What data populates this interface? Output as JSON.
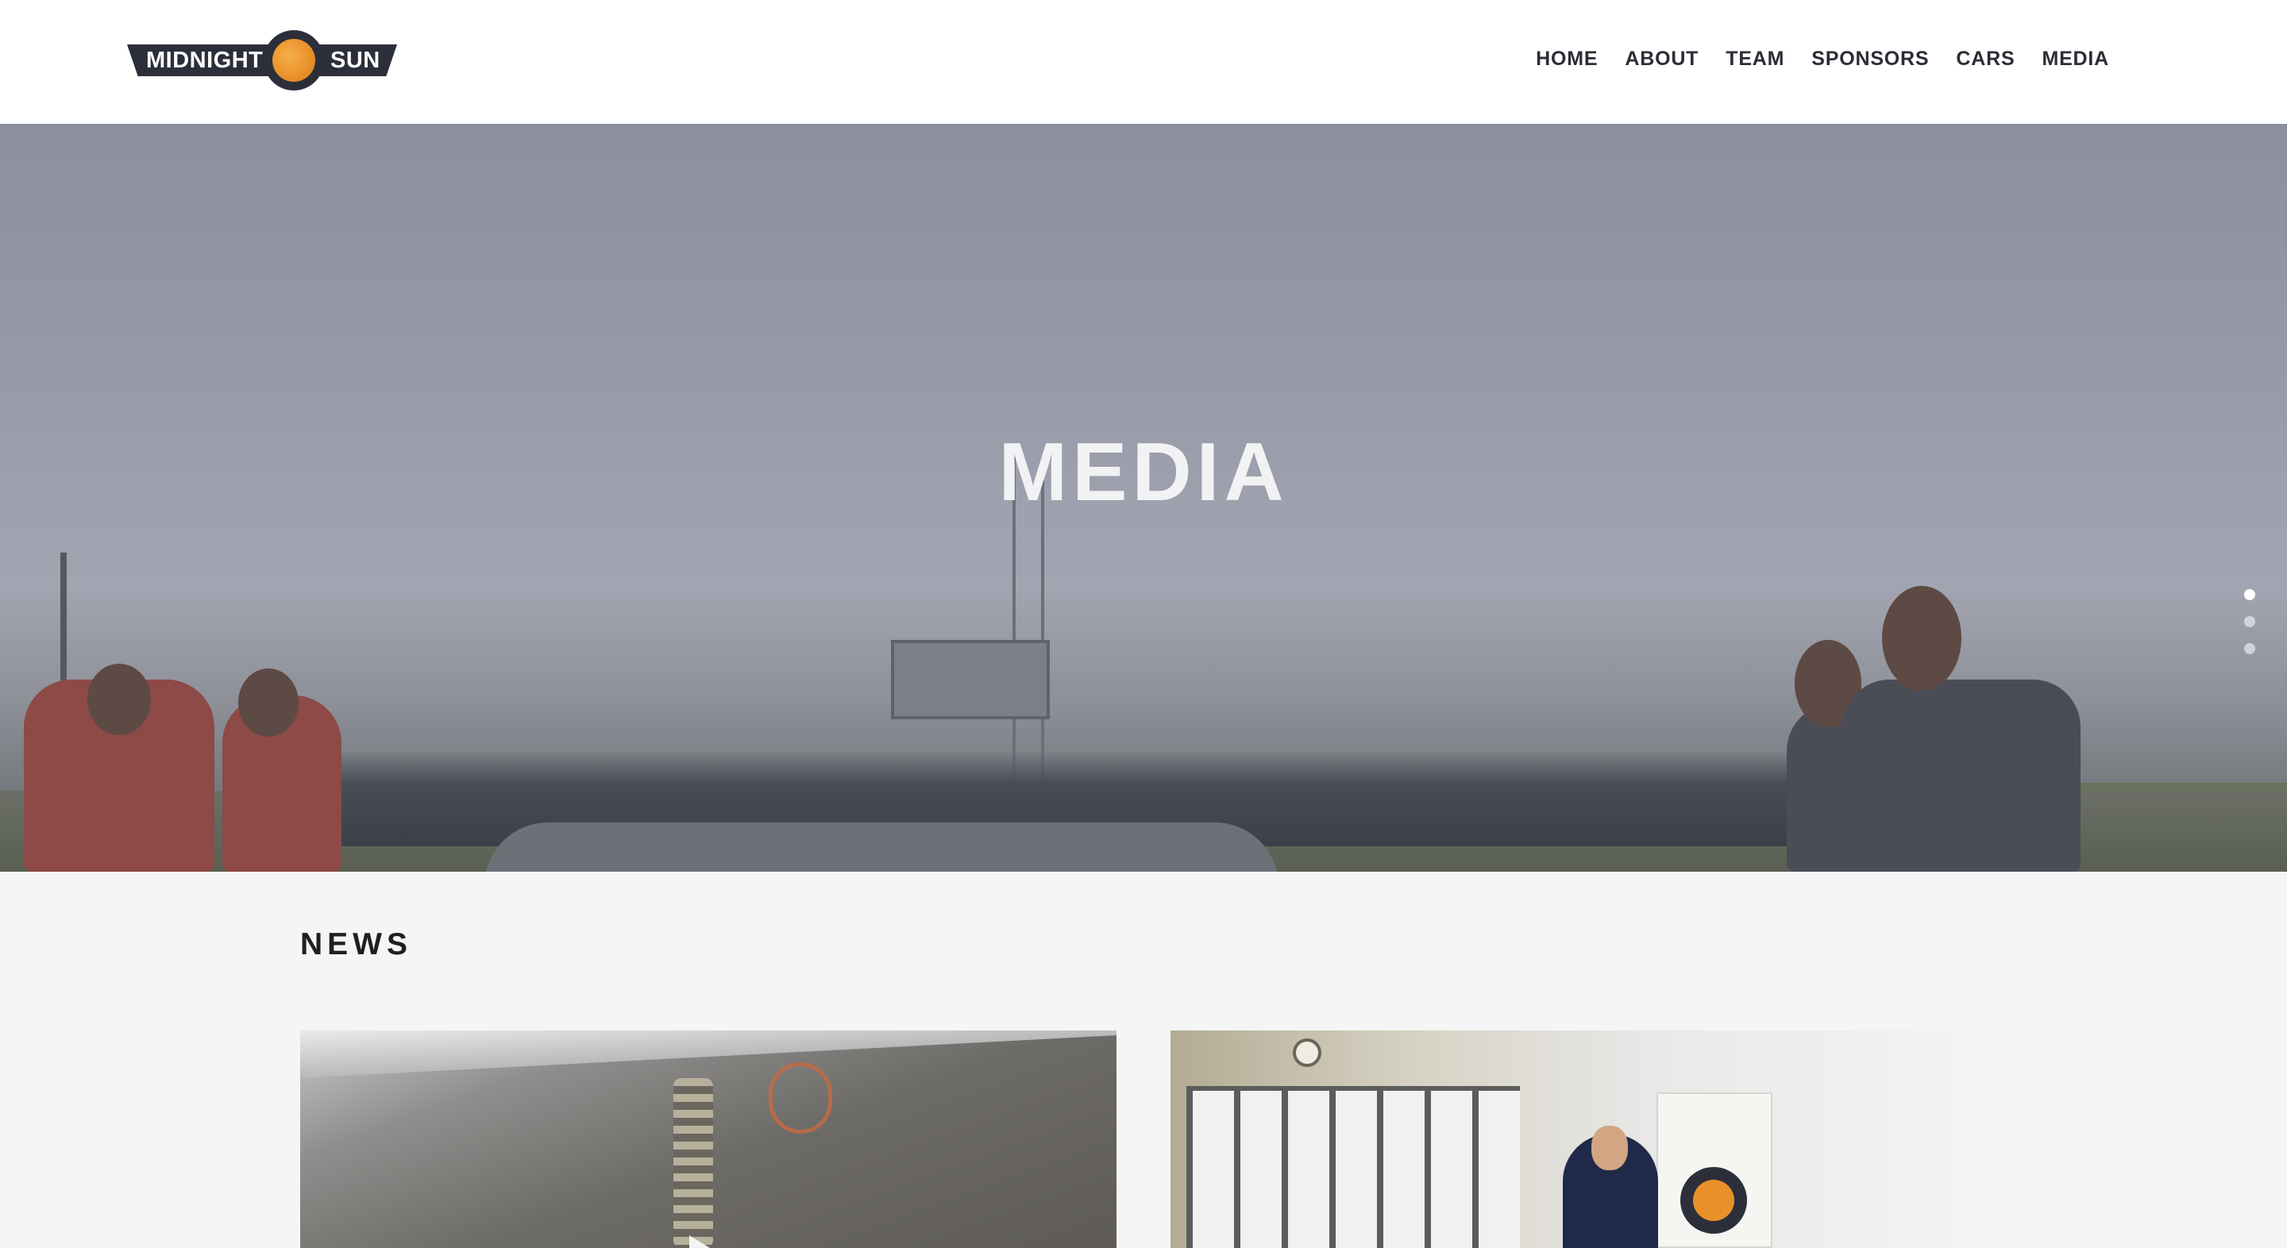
{
  "brand": {
    "name_left": "MIDNIGHT",
    "name_right": "SUN"
  },
  "nav": {
    "items": [
      {
        "label": "HOME"
      },
      {
        "label": "ABOUT"
      },
      {
        "label": "TEAM"
      },
      {
        "label": "SPONSORS"
      },
      {
        "label": "CARS"
      },
      {
        "label": "MEDIA"
      }
    ]
  },
  "hero": {
    "title": "MEDIA",
    "slides_total": 3,
    "active_slide": 1
  },
  "news": {
    "heading": "NEWS"
  },
  "colors": {
    "brand_dark": "#2c2f3a",
    "sun_orange": "#e9902a",
    "nav_text": "#2b2d36",
    "page_bg": "#f5f5f5"
  }
}
